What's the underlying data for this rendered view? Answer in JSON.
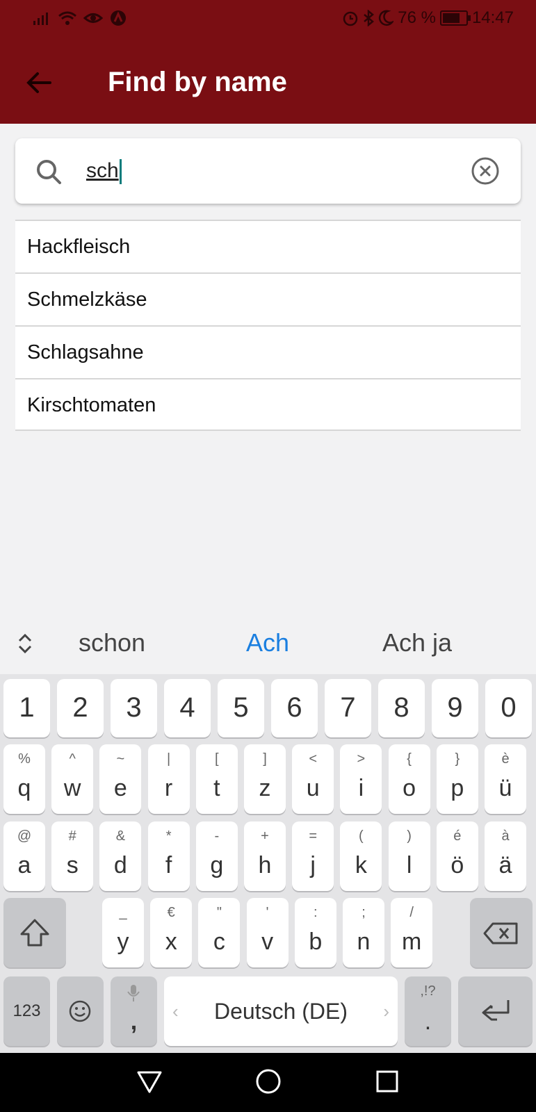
{
  "status": {
    "battery": "76 %",
    "time": "14:47",
    "battery_level": 0.76
  },
  "appbar": {
    "title": "Find by name",
    "back_icon": "arrow-left-icon"
  },
  "search": {
    "value": "sch",
    "icons": [
      "search-icon",
      "clear-icon"
    ]
  },
  "results": [
    {
      "label": "Hackfleisch"
    },
    {
      "label": "Schmelzkäse"
    },
    {
      "label": "Schlagsahne"
    },
    {
      "label": "Kirschtomaten"
    }
  ],
  "suggestions": {
    "items": [
      "schon",
      "Ach",
      "Ach ja"
    ],
    "highlight_color": "#1a7fe0"
  },
  "keyboard": {
    "numbers": [
      "1",
      "2",
      "3",
      "4",
      "5",
      "6",
      "7",
      "8",
      "9",
      "0"
    ],
    "row1": [
      {
        "p": "q",
        "s": "%"
      },
      {
        "p": "w",
        "s": "^"
      },
      {
        "p": "e",
        "s": "~"
      },
      {
        "p": "r",
        "s": "|"
      },
      {
        "p": "t",
        "s": "["
      },
      {
        "p": "z",
        "s": "]"
      },
      {
        "p": "u",
        "s": "<"
      },
      {
        "p": "i",
        "s": ">"
      },
      {
        "p": "o",
        "s": "{"
      },
      {
        "p": "p",
        "s": "}"
      },
      {
        "p": "ü",
        "s": "è"
      }
    ],
    "row2": [
      {
        "p": "a",
        "s": "@"
      },
      {
        "p": "s",
        "s": "#"
      },
      {
        "p": "d",
        "s": "&"
      },
      {
        "p": "f",
        "s": "*"
      },
      {
        "p": "g",
        "s": "-"
      },
      {
        "p": "h",
        "s": "+"
      },
      {
        "p": "j",
        "s": "="
      },
      {
        "p": "k",
        "s": "("
      },
      {
        "p": "l",
        "s": ")"
      },
      {
        "p": "ö",
        "s": "é"
      },
      {
        "p": "ä",
        "s": "à"
      }
    ],
    "row3": [
      {
        "p": "y",
        "s": "_"
      },
      {
        "p": "x",
        "s": "€"
      },
      {
        "p": "c",
        "s": "\""
      },
      {
        "p": "v",
        "s": "'"
      },
      {
        "p": "b",
        "s": ":"
      },
      {
        "p": "n",
        "s": ";"
      },
      {
        "p": "m",
        "s": "/"
      }
    ],
    "key_123": "123",
    "comma": ",",
    "space": "Deutsch (DE)",
    "period": ".",
    "period_alt": ",!?"
  },
  "colors": {
    "appbar": "#7a0e13",
    "accent": "#1a7fe0"
  }
}
